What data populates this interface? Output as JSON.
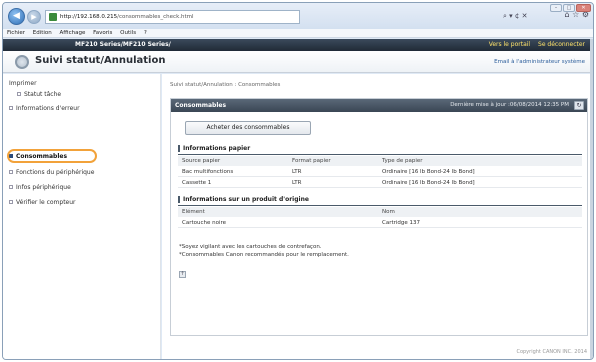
{
  "browser": {
    "url_host": "http://192.168.0.215",
    "url_path": "/consommables_check.html",
    "search_refresh": "⌕ ▾ ¢ ✕",
    "toolbar_icons": "⌂ ☆ ⚙"
  },
  "menu": [
    "Fichier",
    "Edition",
    "Affichage",
    "Favoris",
    "Outils",
    "?"
  ],
  "product_bar": {
    "model": "MF210 Series/MF210 Series/",
    "portal_link": "Vers le portail",
    "logout_link": "Se déconnecter"
  },
  "page": {
    "title": "Suivi statut/Annulation",
    "mail_link": "Email à l'administrateur système",
    "breadcrumb": "Suivi statut/Annulation : Consommables",
    "copyright": "Copyright CANON INC. 2014"
  },
  "sidebar": {
    "title": "Imprimer",
    "items": [
      {
        "label": "Statut tâche"
      },
      {
        "label": "Informations d'erreur"
      },
      {
        "label": "Consommables"
      },
      {
        "label": "Fonctions du périphérique"
      },
      {
        "label": "Infos périphérique"
      },
      {
        "label": "Vérifier le compteur"
      }
    ]
  },
  "panel": {
    "title": "Consommables",
    "last_update": "Dernière mise à jour :06/08/2014 12:35 PM",
    "buy_button": "Acheter des consommables",
    "paper": {
      "title": "Informations papier",
      "headers": [
        "Source papier",
        "Format papier",
        "Type de papier"
      ],
      "rows": [
        [
          "Bac multifonctions",
          "LTR",
          "Ordinaire [16 lb Bond-24 lb Bond]"
        ],
        [
          "Cassette 1",
          "LTR",
          "Ordinaire [16 lb Bond-24 lb Bond]"
        ]
      ]
    },
    "genuine": {
      "title": "Informations sur un produit d'origine",
      "headers": [
        "Elément",
        "Nom"
      ],
      "rows": [
        [
          "Cartouche noire",
          "Cartridge 137"
        ]
      ]
    },
    "notes": [
      "*Soyez vigilant avec les cartouches de contrefaçon.",
      "*Consommables Canon recommandés pour le remplacement."
    ]
  },
  "colors": {
    "highlight": "#f2a23a",
    "portal_link": "#ffe36a",
    "header_dark": "#3a4654"
  }
}
